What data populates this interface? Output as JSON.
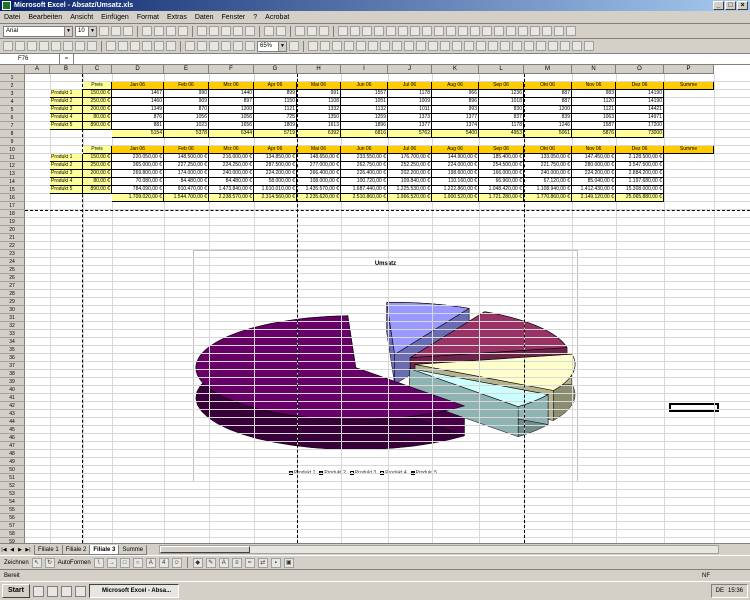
{
  "window": {
    "title": "Microsoft Excel - Absatz/Umsatz.xls"
  },
  "menu": [
    "Datei",
    "Bearbeiten",
    "Ansicht",
    "Einfügen",
    "Format",
    "Extras",
    "Daten",
    "Fenster",
    "?",
    "Acrobat"
  ],
  "toolbar": {
    "font": "Arial",
    "size": "10",
    "zoom": "65%"
  },
  "formula": {
    "namebox": "F76"
  },
  "columns": [
    "A",
    "B",
    "C",
    "D",
    "E",
    "F",
    "G",
    "H",
    "I",
    "J",
    "K",
    "L",
    "M",
    "N",
    "O",
    "P"
  ],
  "table1": {
    "header": [
      "Preis",
      "Jan 06",
      "Feb 06",
      "Mrz 06",
      "Apr 06",
      "Mai 06",
      "Jun 06",
      "Jul 06",
      "Aug 06",
      "Sep 06",
      "Okt 06",
      "Nov 06",
      "Dez 06",
      "Summe"
    ],
    "rows": [
      [
        "Produkt 1",
        "150,00 €",
        "1467",
        "990",
        "1440",
        "899",
        "991",
        "1557",
        "1178",
        "966",
        "1236",
        "887",
        "983",
        "14190"
      ],
      [
        "Produkt 2",
        "250,00 €",
        "1460",
        "909",
        "897",
        "1150",
        "1108",
        "1051",
        "1009",
        "896",
        "1018",
        "887",
        "1120",
        "14190"
      ],
      [
        "Produkt 3",
        "200,00 €",
        "1349",
        "870",
        "1200",
        "1121",
        "1332",
        "1132",
        "1011",
        "993",
        "830",
        "1200",
        "1121",
        "14421"
      ],
      [
        "Produkt 4",
        "80,00 €",
        "876",
        "1056",
        "1056",
        "725",
        "1350",
        "1259",
        "1373",
        "1377",
        "837",
        "839",
        "1063",
        "14971"
      ],
      [
        "Produkt 5",
        "890,00 €",
        "881",
        "1023",
        "1656",
        "1809",
        "1613",
        "1896",
        "1377",
        "1374",
        "1178",
        "1246",
        "1587",
        "17200"
      ]
    ],
    "total": [
      "",
      "",
      "5154",
      "5378",
      "6344",
      "5719",
      "6392",
      "6816",
      "5762",
      "5400",
      "4953",
      "5061",
      "5876",
      "73000"
    ]
  },
  "table2": {
    "header": [
      "Preis",
      "Jan 06",
      "Feb 06",
      "Mrz 06",
      "Apr 06",
      "Mai 06",
      "Jun 06",
      "Jul 06",
      "Aug 06",
      "Sep 06",
      "Okt 06",
      "Nov 06",
      "Dez 06",
      "Summe"
    ],
    "rows": [
      [
        "Produkt 1",
        "150,00 €",
        "220.050,00 €",
        "148.500,00 €",
        "216.000,00 €",
        "134.850,00 €",
        "148.650,00 €",
        "233.550,00 €",
        "176.700,00 €",
        "144.900,00 €",
        "185.400,00 €",
        "133.050,00 €",
        "147.450,00 €",
        "2.128.500,00 €"
      ],
      [
        "Produkt 2",
        "250,00 €",
        "365.000,00 €",
        "227.250,00 €",
        "224.250,00 €",
        "287.500,00 €",
        "277.000,00 €",
        "262.750,00 €",
        "252.250,00 €",
        "224.000,00 €",
        "254.500,00 €",
        "221.750,00 €",
        "280.000,00 €",
        "3.547.500,00 €"
      ],
      [
        "Produkt 3",
        "200,00 €",
        "269.800,00 €",
        "174.000,00 €",
        "240.000,00 €",
        "224.200,00 €",
        "266.400,00 €",
        "226.400,00 €",
        "202.200,00 €",
        "198.600,00 €",
        "166.000,00 €",
        "240.000,00 €",
        "224.200,00 €",
        "2.884.200,00 €"
      ],
      [
        "Produkt 4",
        "80,00 €",
        "70.080,00 €",
        "84.480,00 €",
        "84.480,00 €",
        "58.000,00 €",
        "108.000,00 €",
        "100.720,00 €",
        "109.840,00 €",
        "110.160,00 €",
        "66.960,00 €",
        "67.120,00 €",
        "85.040,00 €",
        "1.197.680,00 €"
      ],
      [
        "Produkt 5",
        "890,00 €",
        "784.090,00 €",
        "910.470,00 €",
        "1.473.840,00 €",
        "1.610.010,00 €",
        "1.435.570,00 €",
        "1.687.440,00 €",
        "1.225.530,00 €",
        "1.222.860,00 €",
        "1.048.420,00 €",
        "1.108.940,00 €",
        "1.412.430,00 €",
        "15.308.000,00 €"
      ]
    ],
    "total": [
      "",
      "",
      "1.709.020,00 €",
      "1.544.700,00 €",
      "2.238.570,00 €",
      "2.314.560,00 €",
      "2.235.620,00 €",
      "2.510.860,00 €",
      "1.966.520,00 €",
      "1.900.520,00 €",
      "1.721.280,00 €",
      "1.770.860,00 €",
      "2.149.120,00 €",
      "25.065.880,00 €"
    ]
  },
  "chart_data": {
    "type": "pie",
    "title": "Umsatz",
    "categories": [
      "Produkt 1",
      "Produkt 2",
      "Produkt 3",
      "Produkt 4",
      "Produkt 5"
    ],
    "values": [
      2128500,
      3547500,
      2884200,
      1197680,
      15308000
    ],
    "colors": [
      "#9999ff",
      "#993366",
      "#ffffcc",
      "#ccffff",
      "#660066"
    ],
    "legend": "bottom"
  },
  "sheets": [
    "Filiale 1",
    "Filiale 2",
    "Filiale 3",
    "Summe"
  ],
  "activeSheet": 2,
  "drawbar": {
    "zeichnen": "Zeichnen",
    "autoformen": "AutoFormen"
  },
  "status": {
    "left": "Bereit",
    "right": "NF"
  },
  "taskbar": {
    "start": "Start",
    "task": "Microsoft Excel - Absa...",
    "time": "15:36"
  }
}
